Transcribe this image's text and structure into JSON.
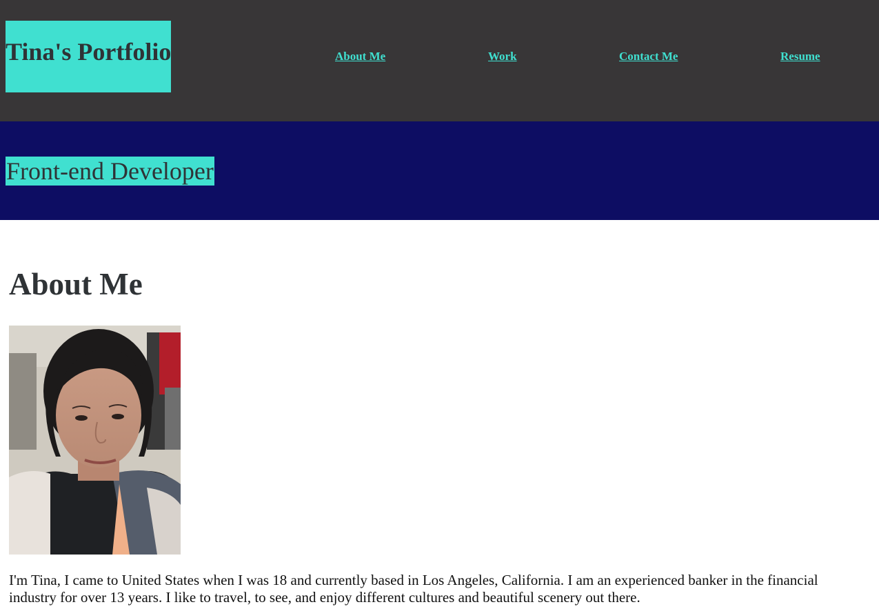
{
  "header": {
    "site_title": "Tina's Portfolio",
    "nav": [
      {
        "label": "About Me"
      },
      {
        "label": "Work"
      },
      {
        "label": "Contact Me"
      },
      {
        "label": "Resume"
      }
    ]
  },
  "hero": {
    "subtitle": "Front-end Developer"
  },
  "about": {
    "heading": "About Me",
    "photo_icon": "profile-photo",
    "bio": "I'm Tina, I came to United States when I was 18 and currently based in Los Angeles, California. I am an experienced banker in the financial industry for over 13 years. I like to travel, to see, and enjoy different cultures and beautiful scenery out there."
  },
  "colors": {
    "header_bg": "#383637",
    "hero_bg": "#0d0d63",
    "accent": "#40e0d0",
    "heading_text": "#2f3336"
  }
}
